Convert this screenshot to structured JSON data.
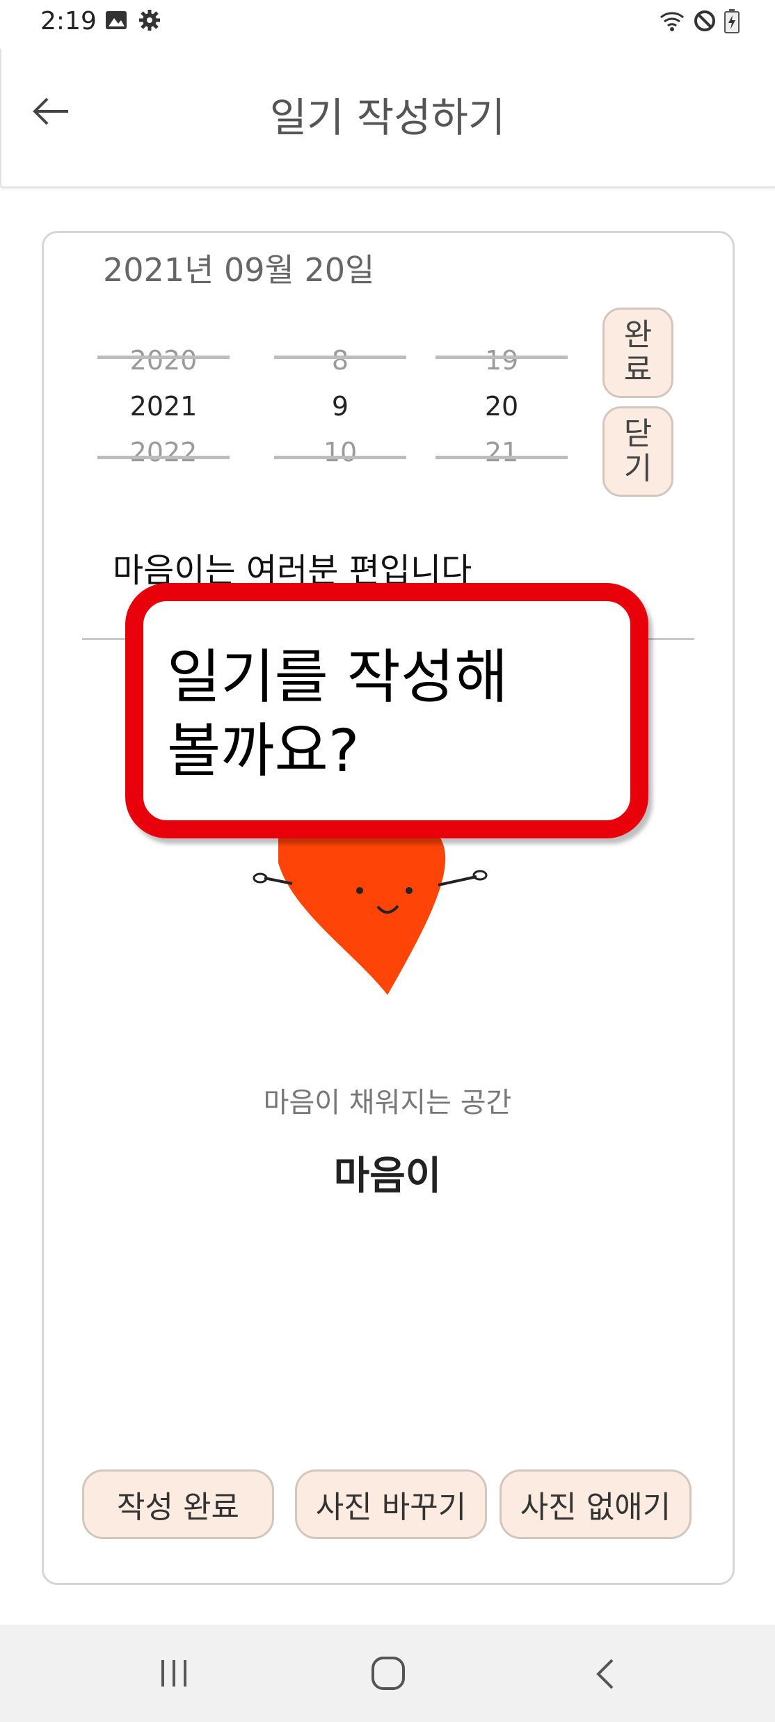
{
  "status_bar": {
    "time": "2:19",
    "left_icons": [
      "image-icon",
      "gear-icon"
    ],
    "right_icons": [
      "wifi-icon",
      "do-not-disturb-icon",
      "battery-icon"
    ]
  },
  "app_bar": {
    "title": "일기 작성하기",
    "back_icon": "back-arrow-icon"
  },
  "diary": {
    "date_label": "2021년 09월 20일",
    "picker": {
      "year": {
        "prev": "2020",
        "selected": "2021",
        "next": "2022"
      },
      "month": {
        "prev": "8",
        "selected": "9",
        "next": "10"
      },
      "day": {
        "prev": "19",
        "selected": "20",
        "next": "21"
      }
    },
    "done_label": "완\n료",
    "close_label": "닫\n기",
    "headline": "마음이는 여러분 편입니다",
    "caption": "마음이 채워지는 공간",
    "logo_text": "마음이"
  },
  "tooltip": {
    "text": "일기를 작성해\n볼까요?"
  },
  "bottom_buttons": {
    "complete": "작성 완료",
    "change_photo": "사진 바꾸기",
    "remove_photo": "사진 없애기"
  },
  "nav_bar": {
    "icons": [
      "recent-apps-icon",
      "home-icon",
      "back-icon"
    ]
  },
  "colors": {
    "accent_red": "#e8000b",
    "heart": "#ff4408",
    "button_bg": "#fbebe0"
  }
}
